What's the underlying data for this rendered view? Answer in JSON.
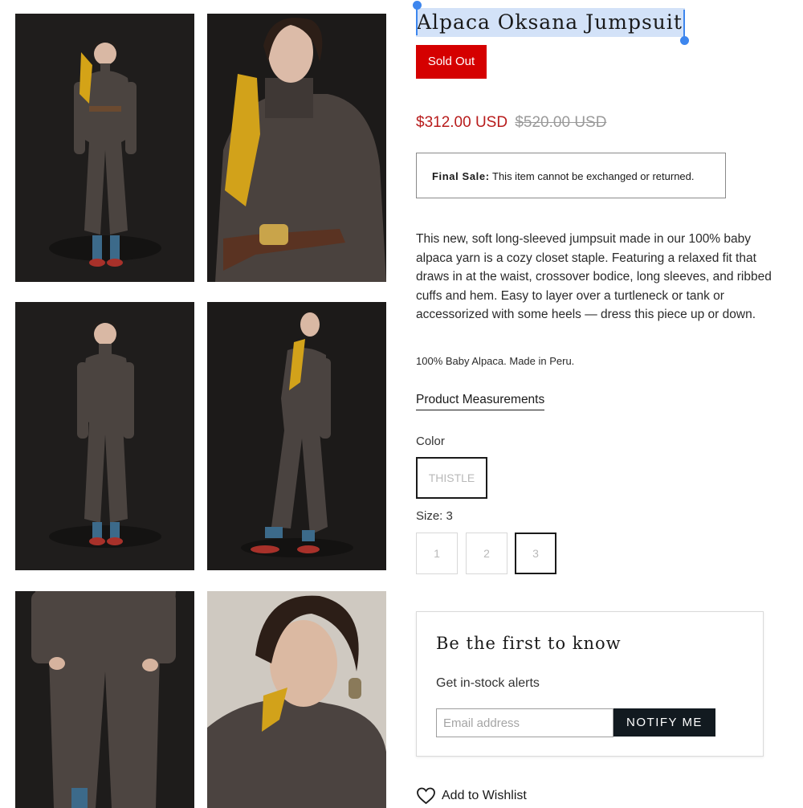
{
  "product": {
    "title": "Alpaca Oksana Jumpsuit",
    "badge": "Sold Out",
    "price_current": "$312.00 USD",
    "price_original": "$520.00 USD",
    "final_sale_label": "Final Sale:",
    "final_sale_text": "This item cannot be exchanged or returned.",
    "description": "This new, soft long-sleeved jumpsuit made in our 100% baby alpaca yarn is a cozy closet staple. Featuring a relaxed fit that draws in at the waist, crossover bodice, long sleeves, and ribbed cuffs and hem. Easy to layer over a turtleneck or tank or accessorized with some heels — dress this piece up or down.",
    "material": "100% Baby Alpaca. Made in Peru.",
    "measurements_link": "Product Measurements"
  },
  "options": {
    "color_label": "Color",
    "color_value": "THISTLE",
    "size_label": "Size: 3",
    "sizes": [
      "1",
      "2",
      "3"
    ],
    "selected_size": "3"
  },
  "notify": {
    "title": "Be the first to know",
    "subtitle": "Get in-stock alerts",
    "email_placeholder": "Email address",
    "button_label": "NOTIFY ME"
  },
  "wishlist": {
    "label": "Add to Wishlist"
  },
  "colors": {
    "sold_out": "#d50000",
    "price": "#b81c1c",
    "button": "#121a20",
    "selection": "#d3e2f8",
    "selection_handle": "#3d86ee"
  },
  "icons": {
    "wishlist": "heart-icon"
  }
}
